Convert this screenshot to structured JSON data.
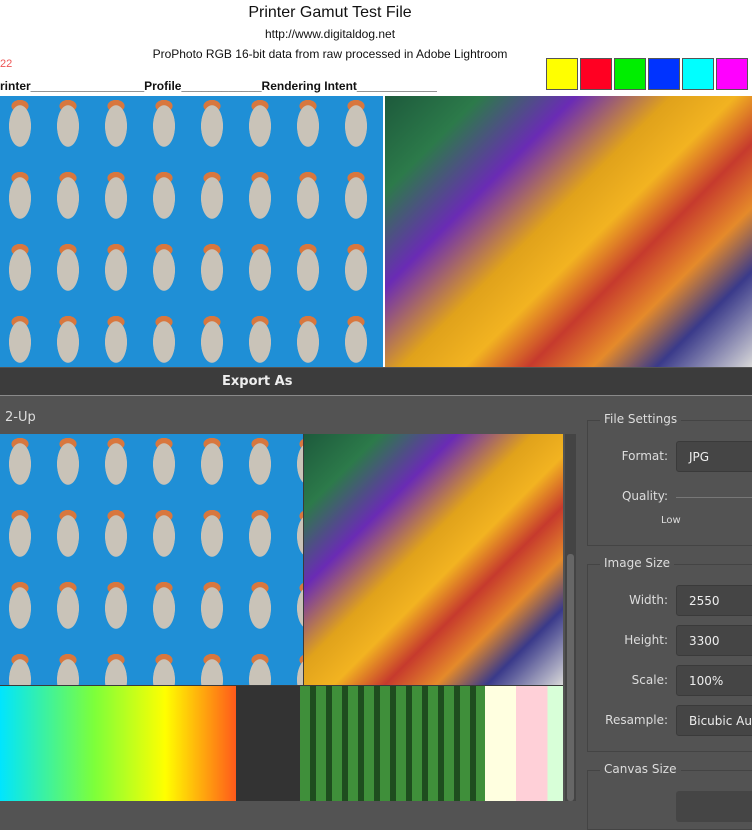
{
  "document": {
    "title": "Printer Gamut Test File",
    "url": "http://www.digitaldog.net",
    "subtitle": "ProPhoto RGB 16-bit data from raw processed in Adobe Lightroom",
    "fragment": "22",
    "form_line": "rinter_________________Profile____________Rendering Intent____________",
    "swatches": [
      "#ffff00",
      "#ff0022",
      "#00ee00",
      "#0033ff",
      "#00ffff",
      "#ff00ff"
    ]
  },
  "dialog": {
    "title": "Export As",
    "view_mode": "2-Up",
    "file_settings": {
      "title": "File Settings",
      "format_label": "Format:",
      "format_value": "JPG",
      "quality_label": "Quality:",
      "quality_low": "Low"
    },
    "image_size": {
      "title": "Image Size",
      "width_label": "Width:",
      "width_value": "2550",
      "height_label": "Height:",
      "height_value": "3300",
      "scale_label": "Scale:",
      "scale_value": "100%",
      "resample_label": "Resample:",
      "resample_value": "Bicubic Automatic"
    },
    "canvas_size": {
      "title": "Canvas Size"
    }
  }
}
